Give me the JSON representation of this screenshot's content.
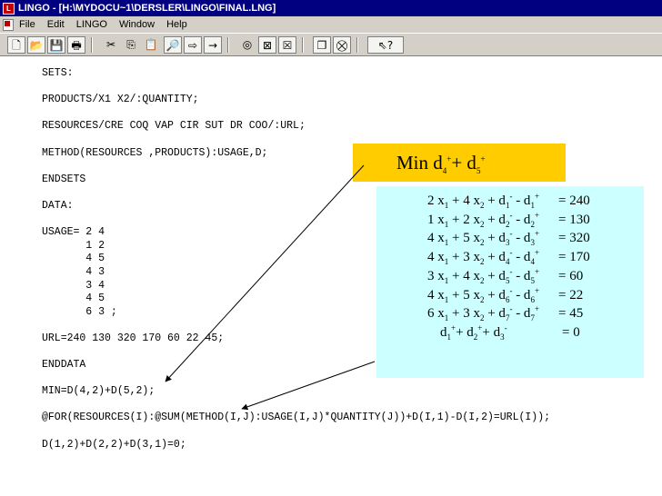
{
  "window": {
    "title": "LINGO - [H:\\MYDOCU~1\\DERSLER\\LINGO\\FINAL.LNG]"
  },
  "menu": {
    "items": [
      "File",
      "Edit",
      "LINGO",
      "Window",
      "Help"
    ]
  },
  "toolbar": {
    "buttons": [
      {
        "name": "new-file-icon",
        "glyph": "🗋"
      },
      {
        "name": "open-file-icon",
        "glyph": "📂"
      },
      {
        "name": "save-icon",
        "glyph": "💾"
      },
      {
        "name": "print-icon",
        "glyph": "🖶"
      },
      {
        "name": "cut-icon",
        "glyph": "✂"
      },
      {
        "name": "copy-icon",
        "glyph": "⎘"
      },
      {
        "name": "paste-icon",
        "glyph": "📋"
      },
      {
        "name": "find-icon",
        "glyph": "🔎"
      },
      {
        "name": "find-next-icon",
        "glyph": "⇨"
      },
      {
        "name": "goto-line-icon",
        "glyph": "→"
      },
      {
        "name": "solve-icon",
        "glyph": "◎"
      },
      {
        "name": "solution-icon",
        "glyph": "⊠"
      },
      {
        "name": "close-all-icon",
        "glyph": "☒"
      },
      {
        "name": "tile-windows-icon",
        "glyph": "❐"
      },
      {
        "name": "options-icon",
        "glyph": "⛒"
      },
      {
        "name": "help-pointer-icon",
        "glyph": "⇖?"
      }
    ]
  },
  "code_lines": [
    "SETS:",
    "",
    "PRODUCTS/X1 X2/:QUANTITY;",
    "",
    "RESOURCES/CRE COQ VAP CIR SUT DR COO/:URL;",
    "",
    "METHOD(RESOURCES ,PRODUCTS):USAGE,D;",
    "",
    "ENDSETS",
    "",
    "DATA:",
    "",
    "USAGE= 2 4",
    "       1 2",
    "       4 5",
    "       4 3",
    "       3 4",
    "       4 5",
    "       6 3 ;",
    "",
    "URL=240 130 320 170 60 22 45;",
    "",
    "ENDDATA",
    "",
    "MIN=D(4,2)+D(5,2);",
    "",
    "@FOR(RESOURCES(I):@SUM(METHOD(I,J):USAGE(I,J)*QUANTITY(J))+D(I,1)-D(I,2)=URL(I));",
    "",
    "D(1,2)+D(2,2)+D(3,1)=0;"
  ],
  "objective": {
    "html": "Min d<sub>4</sub><sup>+</sup>+ d<sub>5</sub><sup>+</sup>"
  },
  "constraints": [
    {
      "lhs": "2 x<sub>1</sub> + 4 x<sub>2</sub> + d<sub>1</sub><sup>-</sup>  - d<sub>1</sub><sup>+</sup>",
      "rhs": "= 240"
    },
    {
      "lhs": "1 x<sub>1</sub> + 2 x<sub>2</sub> + d<sub>2</sub><sup>-</sup>  - d<sub>2</sub><sup>+</sup>",
      "rhs": "= 130"
    },
    {
      "lhs": "4 x<sub>1</sub> + 5 x<sub>2</sub> + d<sub>3</sub><sup>-</sup>  - d<sub>3</sub><sup>+</sup>",
      "rhs": "= 320"
    },
    {
      "lhs": "4 x<sub>1</sub> + 3 x<sub>2</sub> + d<sub>4</sub><sup>-</sup>  - d<sub>4</sub><sup>+</sup>",
      "rhs": "= 170"
    },
    {
      "lhs": "3 x<sub>1</sub> + 4 x<sub>2</sub> + d<sub>5</sub><sup>-</sup>  - d<sub>5</sub><sup>+</sup>",
      "rhs": "= 60"
    },
    {
      "lhs": "4 x<sub>1</sub> + 5 x<sub>2</sub> + d<sub>6</sub><sup>-</sup>  - d<sub>6</sub><sup>+</sup>",
      "rhs": "= 22"
    },
    {
      "lhs": "6 x<sub>1</sub> + 3 x<sub>2</sub> + d<sub>7</sub><sup>-</sup>  - d<sub>7</sub><sup>+</sup>",
      "rhs": "= 45"
    },
    {
      "lhs": "d<sub>1</sub><sup>+</sup>+ d<sub>2</sub><sup>+</sup>+ d<sub>3</sub><sup>-</sup>",
      "rhs": "= 0"
    }
  ],
  "colors": {
    "titlebar": "#000080",
    "objective_box": "#ffcc00",
    "constraint_box": "#ccffff"
  }
}
